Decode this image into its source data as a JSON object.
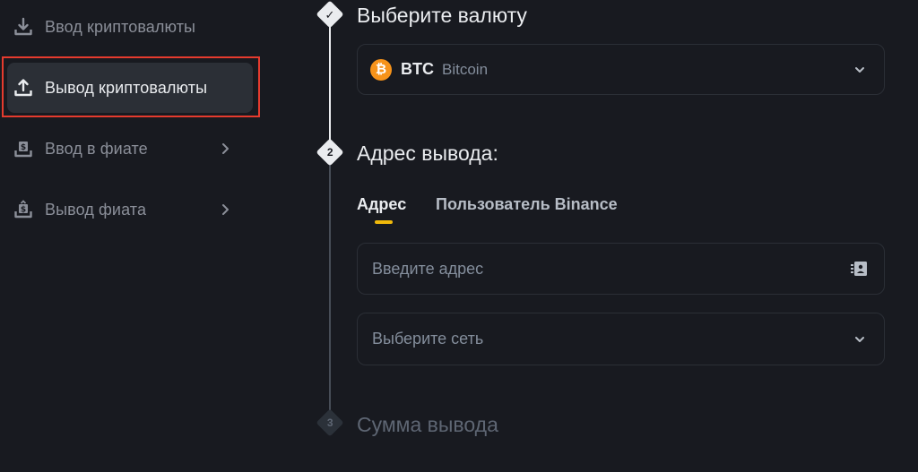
{
  "sidebar": {
    "items": [
      {
        "label": "Ввод криптовалюты",
        "icon": "download-icon",
        "active": false,
        "has_submenu": false
      },
      {
        "label": "Вывод криптовалюты",
        "icon": "upload-icon",
        "active": true,
        "has_submenu": false
      },
      {
        "label": "Ввод в фиате",
        "icon": "fiat-deposit-icon",
        "active": false,
        "has_submenu": true
      },
      {
        "label": "Вывод фиата",
        "icon": "fiat-withdraw-icon",
        "active": false,
        "has_submenu": true
      }
    ]
  },
  "steps": [
    {
      "number": "✓",
      "title": "Выберите валюту",
      "status": "done"
    },
    {
      "number": "2",
      "title": "Адрес вывода:",
      "status": "current"
    },
    {
      "number": "3",
      "title": "Сумма вывода",
      "status": "pending"
    }
  ],
  "currency": {
    "icon_letter": "₿",
    "symbol": "BTC",
    "name": "Bitcoin"
  },
  "address_tabs": [
    {
      "label": "Адрес",
      "active": true
    },
    {
      "label": "Пользователь Binance",
      "active": false
    }
  ],
  "address_input": {
    "placeholder": "Введите адрес",
    "value": ""
  },
  "network_select": {
    "placeholder": "Выберите сеть"
  },
  "colors": {
    "background": "#181a20",
    "accent": "#f0b90b",
    "bitcoin": "#f7931a",
    "highlight": "#e53b2e"
  }
}
